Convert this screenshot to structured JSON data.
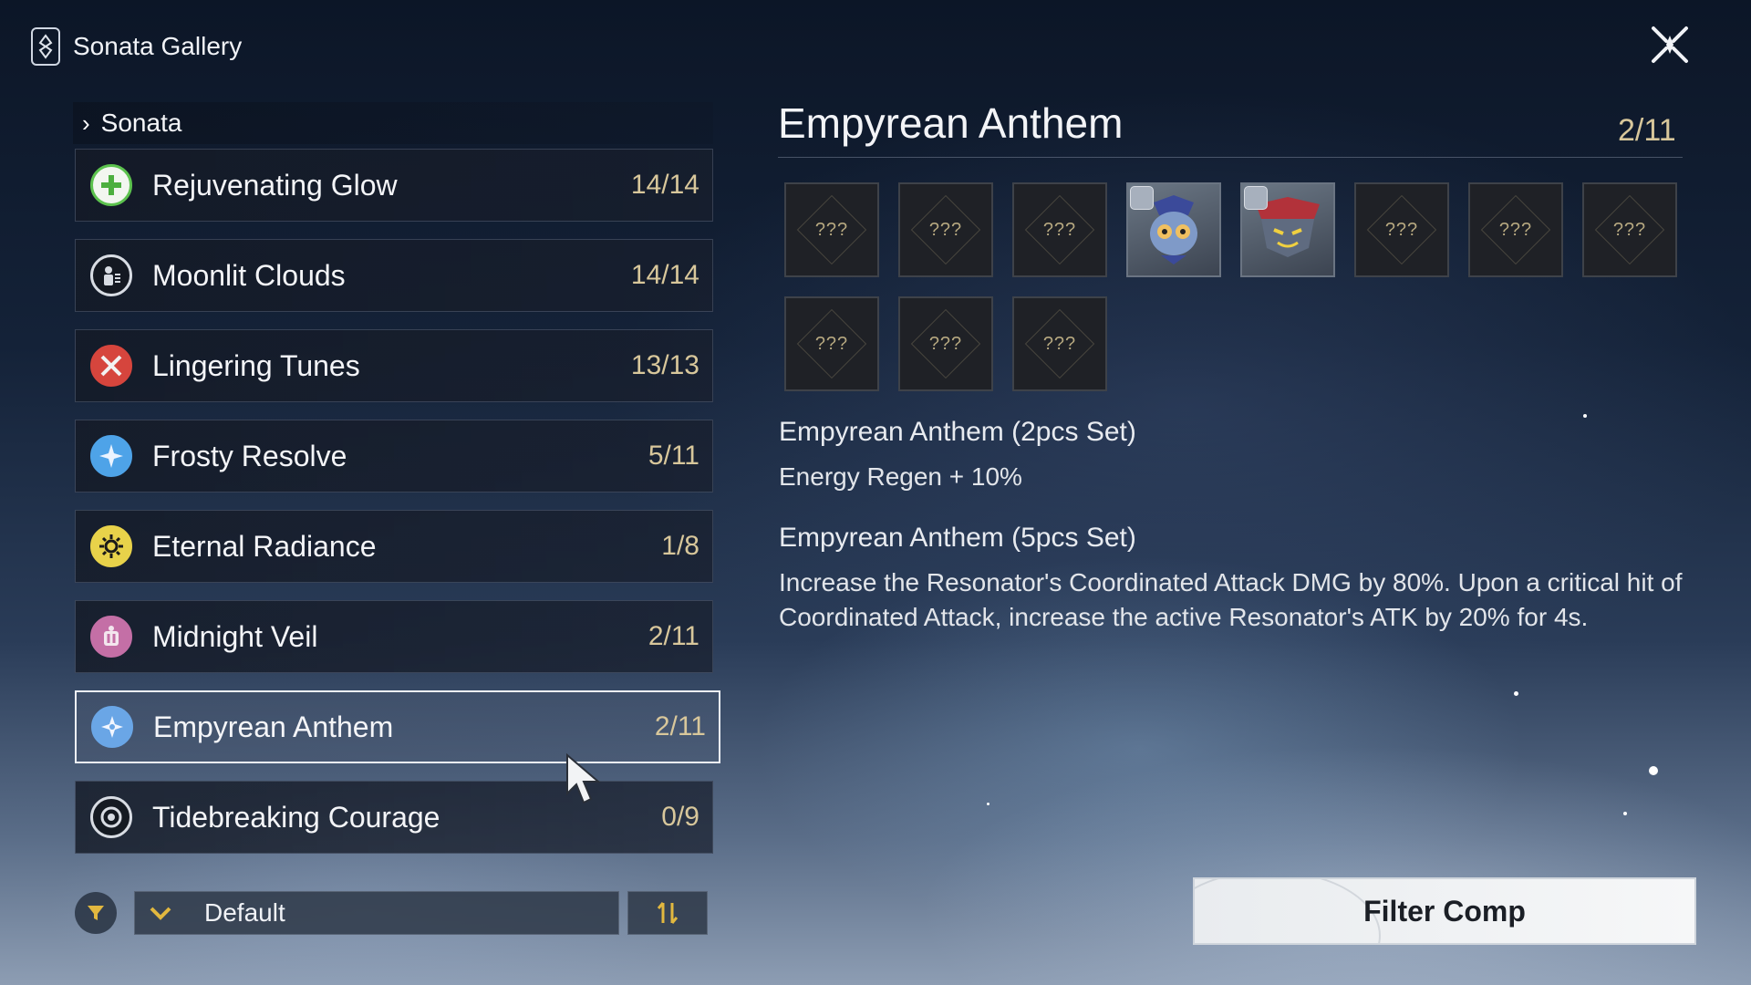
{
  "app": {
    "title": "Sonata Gallery"
  },
  "sidebar": {
    "section_label": "Sonata",
    "items": [
      {
        "name": "Rejuvenating Glow",
        "count": "14/14",
        "icon": "plus-cross-icon",
        "color": "#5cc24e"
      },
      {
        "name": "Moonlit Clouds",
        "count": "14/14",
        "icon": "moonlit-icon",
        "color": "#d8dce3"
      },
      {
        "name": "Lingering Tunes",
        "count": "13/13",
        "icon": "crossed-swords-icon",
        "color": "#d6453d"
      },
      {
        "name": "Frosty Resolve",
        "count": "5/11",
        "icon": "frost-star-icon",
        "color": "#4ea3e8"
      },
      {
        "name": "Eternal Radiance",
        "count": "1/8",
        "icon": "sun-icon",
        "color": "#e8d24a"
      },
      {
        "name": "Midnight Veil",
        "count": "2/11",
        "icon": "veil-icon",
        "color": "#c46fa6"
      },
      {
        "name": "Empyrean Anthem",
        "count": "2/11",
        "icon": "anthem-star-icon",
        "color": "#6aa6e6",
        "selected": true
      },
      {
        "name": "Tidebreaking Courage",
        "count": "0/9",
        "icon": "tide-ring-icon",
        "color": "#d8dce3"
      }
    ],
    "sort_value": "Default"
  },
  "detail": {
    "title": "Empyrean Anthem",
    "count": "2/11",
    "unknown_label": "???",
    "slots": [
      "unknown",
      "unknown",
      "unknown",
      "owned",
      "owned",
      "unknown",
      "unknown",
      "unknown",
      "unknown",
      "unknown",
      "unknown"
    ],
    "set2_title": "Empyrean Anthem (2pcs Set)",
    "set2_text": "Energy Regen + 10%",
    "set5_title": "Empyrean Anthem (5pcs Set)",
    "set5_text": "Increase the Resonator's Coordinated Attack DMG by 80%. Upon a critical hit of Coordinated Attack, increase the active Resonator's ATK by 20% for 4s."
  },
  "actions": {
    "filter_comp_label": "Filter Comp"
  }
}
